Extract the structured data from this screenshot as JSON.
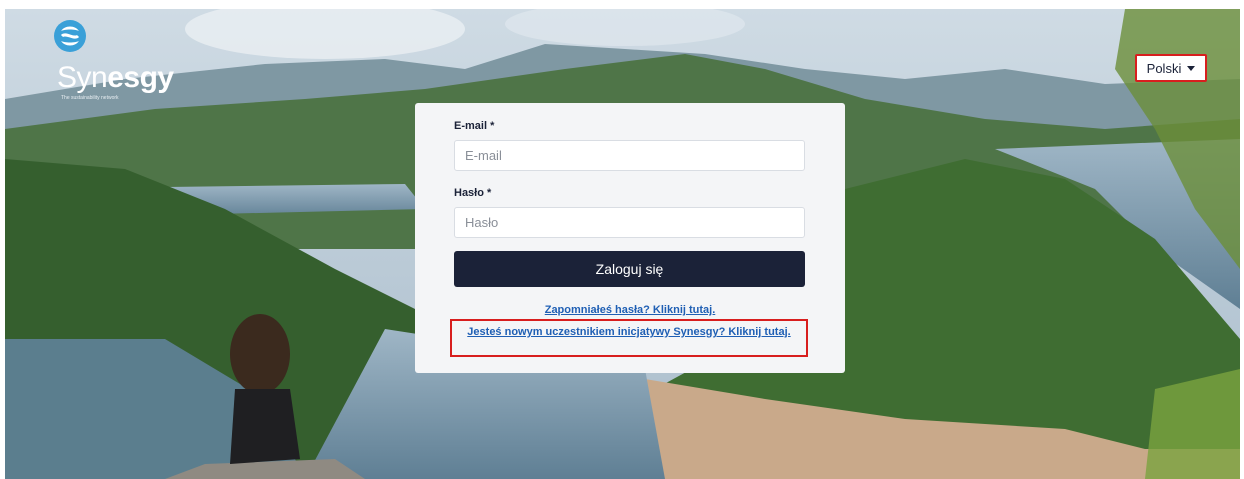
{
  "brand": {
    "name_light": "Syn",
    "name_bold": "esgy",
    "tagline": "The sustainability network"
  },
  "language": {
    "selected": "Polski"
  },
  "login": {
    "email_label": "E-mail *",
    "email_placeholder": "E-mail",
    "password_label": "Hasło *",
    "password_placeholder": "Hasło",
    "submit_label": "Zaloguj się",
    "forgot_link": "Zapomniałeś hasła? Kliknij tutaj.",
    "register_link": "Jesteś nowym uczestnikiem inicjatywy Synesgy? Kliknij tutaj."
  },
  "colors": {
    "primary": "#1b2238",
    "link": "#1f5fb4",
    "highlight": "#d81e1e"
  }
}
